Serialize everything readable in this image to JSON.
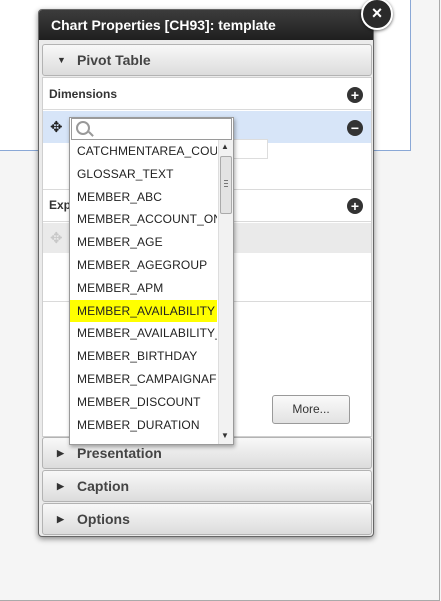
{
  "dialog": {
    "title": "Chart Properties [CH93]: template",
    "close_glyph": "×"
  },
  "sections": {
    "pivot_table": "Pivot Table",
    "presentation": "Presentation",
    "caption": "Caption",
    "options": "Options"
  },
  "pivot": {
    "dimensions_label": "Dimensions",
    "expressions_label": "Exp",
    "more_button": "More..."
  },
  "dropdown": {
    "search_value": "",
    "selected_index": 7,
    "items": [
      "CATCHMENTAREA_COUNTRY",
      "GLOSSAR_TEXT",
      "MEMBER_ABC",
      "MEMBER_ACCOUNT_ONLINE",
      "MEMBER_AGE",
      "MEMBER_AGEGROUP",
      "MEMBER_APM",
      "MEMBER_AVAILABILITY",
      "MEMBER_AVAILABILITY_DATE",
      "MEMBER_BIRTHDAY",
      "MEMBER_CAMPAIGNAFFINITY",
      "MEMBER_DISCOUNT",
      "MEMBER_DURATION"
    ]
  },
  "icons": {
    "move": "✥",
    "plus": "+",
    "minus": "−",
    "tri_down": "▼",
    "tri_right": "▶",
    "scroll_up": "▲",
    "scroll_down": "▼"
  }
}
